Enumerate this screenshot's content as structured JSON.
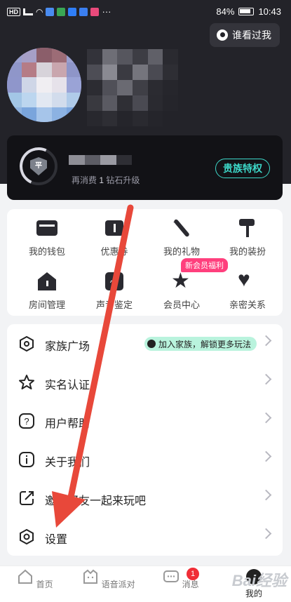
{
  "status_bar": {
    "left_label": "HD",
    "battery_percent": "84%",
    "time": "10:43",
    "dots": "···"
  },
  "header": {
    "viewed_me_label": "谁看过我"
  },
  "vip_card": {
    "sub_prefix": "再消费",
    "sub_count": "1",
    "sub_suffix": "钻石升级",
    "privilege_button": "贵族特权",
    "level_glyph": "平"
  },
  "grid": {
    "items": [
      {
        "label": "我的钱包",
        "icon": "wallet-icon"
      },
      {
        "label": "优惠券",
        "icon": "coupon-icon"
      },
      {
        "label": "我的礼物",
        "icon": "magic-wand-icon"
      },
      {
        "label": "我的装扮",
        "icon": "paint-roller-icon"
      },
      {
        "label": "房间管理",
        "icon": "house-icon"
      },
      {
        "label": "声音鉴定",
        "icon": "voice-wave-icon"
      },
      {
        "label": "会员中心",
        "icon": "vip-star-icon"
      },
      {
        "label": "亲密关系",
        "icon": "heart-icon"
      }
    ],
    "new_member_badge": "新会员福利"
  },
  "menu": {
    "items": [
      {
        "label": "家族广场",
        "icon": "family-icon"
      },
      {
        "label": "实名认证",
        "icon": "star-badge-icon"
      },
      {
        "label": "用户帮助",
        "icon": "help-icon"
      },
      {
        "label": "关于我们",
        "icon": "info-icon"
      },
      {
        "label": "邀请好友一起来玩吧",
        "icon": "share-icon"
      },
      {
        "label": "设置",
        "icon": "settings-icon"
      }
    ],
    "family_tag": "加入家族，解锁更多玩法"
  },
  "tabbar": {
    "tabs": [
      {
        "label": "首页"
      },
      {
        "label": "语音派对"
      },
      {
        "label": "消息"
      },
      {
        "label": "我的"
      }
    ],
    "message_count": "1"
  },
  "colors": {
    "accent": "#3dd8c9",
    "header_bg": "#232329",
    "badge_pink": "#ff3f7d",
    "arrow_red": "#e8483a"
  },
  "watermark": "Bai经验"
}
